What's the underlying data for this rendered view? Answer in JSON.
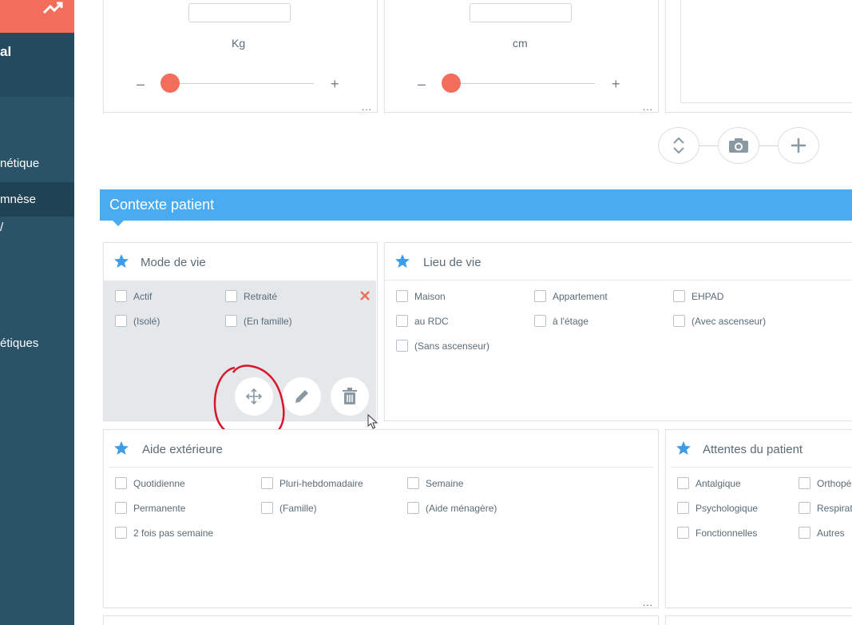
{
  "sidebar": {
    "brand": "al",
    "items": [
      {
        "label": "nétique"
      },
      {
        "label": "mnèse"
      },
      {
        "label": "/"
      },
      {
        "label": "étiques"
      }
    ]
  },
  "measures": {
    "weight_unit": "Kg",
    "height_unit": "cm",
    "more": "..."
  },
  "section": {
    "title": "Contexte patient"
  },
  "mode_de_vie": {
    "title": "Mode de vie",
    "options": [
      "Actif",
      "Retraité",
      "(Isolé)",
      "(En famille)"
    ]
  },
  "lieu_de_vie": {
    "title": "Lieu de vie",
    "options": [
      "Maison",
      "Appartement",
      "EHPAD",
      "au RDC",
      "à l'étage",
      "(Avec ascenseur)",
      "(Sans ascenseur)"
    ]
  },
  "aide_exterieure": {
    "title": "Aide extérieure",
    "options": [
      "Quotidienne",
      "Pluri-hebdomadaire",
      "Semaine",
      "Permanente",
      "(Famille)",
      "(Aide ménagère)",
      "2 fois pas semaine"
    ]
  },
  "attentes": {
    "title": "Attentes du patient",
    "options": [
      "Antalgique",
      "Orthopé",
      "Psychologique",
      "Respirat",
      "Fonctionnelles",
      "Autres"
    ]
  },
  "colors": {
    "accent": "#4aabf0",
    "danger": "#f26e5a",
    "sidebar": "#2a5368"
  }
}
